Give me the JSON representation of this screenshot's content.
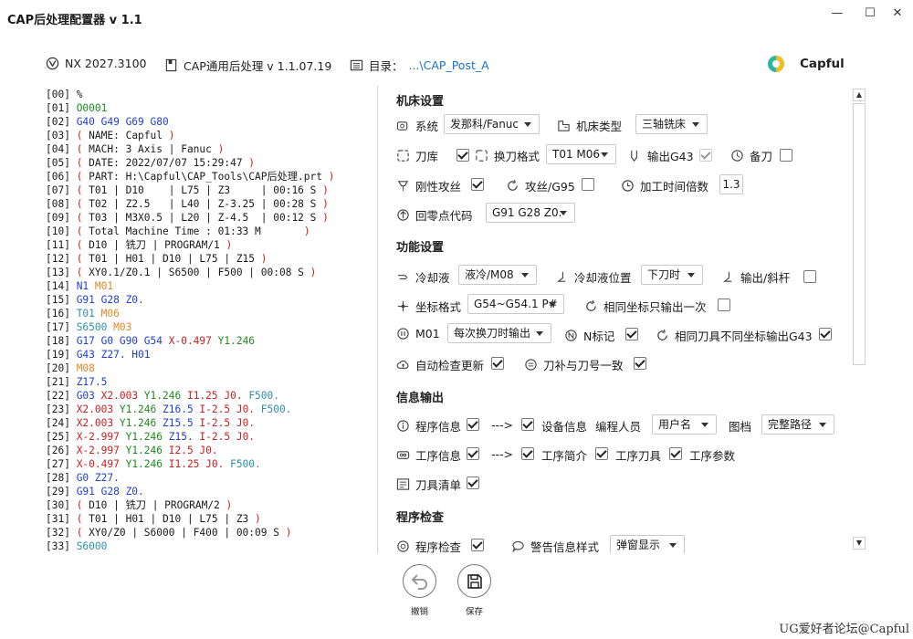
{
  "window": {
    "title": "CAP后处理配置器 v 1.1",
    "minimize": "—",
    "maximize": "☐",
    "close": "✕"
  },
  "info": {
    "nx": "NX 2027.3100",
    "post": "CAP通用后处理 v 1.1.07.19",
    "dir_label": "目录：",
    "dir_value": "...\\CAP_Post_A",
    "brand": "Capful"
  },
  "code_lines": [
    [
      [
        "[00] ",
        "k"
      ],
      [
        "%",
        "k"
      ]
    ],
    [
      [
        "[01] ",
        "k"
      ],
      [
        "O0001",
        "g"
      ]
    ],
    [
      [
        "[02] ",
        "k"
      ],
      [
        "G40 G49 G69 G80",
        "b"
      ]
    ],
    [
      [
        "[03] ",
        "k"
      ],
      [
        "( ",
        "r"
      ],
      [
        "NAME: Capful",
        "k"
      ],
      [
        " )",
        "r"
      ]
    ],
    [
      [
        "[04] ",
        "k"
      ],
      [
        "( ",
        "r"
      ],
      [
        "MACH: 3 Axis | Fanuc",
        "k"
      ],
      [
        " )",
        "r"
      ]
    ],
    [
      [
        "[05] ",
        "k"
      ],
      [
        "( ",
        "r"
      ],
      [
        "DATE: 2022/07/07 15:29:47",
        "k"
      ],
      [
        " )",
        "r"
      ]
    ],
    [
      [
        "[06] ",
        "k"
      ],
      [
        "( ",
        "r"
      ],
      [
        "PART: H:\\Capful\\CAP_Tools\\CAP后处理.prt",
        "k"
      ],
      [
        " )",
        "r"
      ]
    ],
    [
      [
        "[07] ",
        "k"
      ],
      [
        "( ",
        "r"
      ],
      [
        "T01 | D10    | L75 | Z3     | 00:16 S",
        "k"
      ],
      [
        " )",
        "r"
      ]
    ],
    [
      [
        "[08] ",
        "k"
      ],
      [
        "( ",
        "r"
      ],
      [
        "T02 | Z2.5   | L40 | Z-3.25 | 00:28 S",
        "k"
      ],
      [
        " )",
        "r"
      ]
    ],
    [
      [
        "[09] ",
        "k"
      ],
      [
        "( ",
        "r"
      ],
      [
        "T03 | M3X0.5 | L20 | Z-4.5  | 00:12 S",
        "k"
      ],
      [
        " )",
        "r"
      ]
    ],
    [
      [
        "[10] ",
        "k"
      ],
      [
        "( ",
        "r"
      ],
      [
        "Total Machine Time : 01:33 M       ",
        "k"
      ],
      [
        ")",
        "r"
      ]
    ],
    [
      [
        "[11] ",
        "k"
      ],
      [
        "( ",
        "r"
      ],
      [
        "D10 | 铣刀 | PROGRAM/1",
        "k"
      ],
      [
        " )",
        "r"
      ]
    ],
    [
      [
        "[12] ",
        "k"
      ],
      [
        "( ",
        "r"
      ],
      [
        "T01 | H01 | D10 | L75 | Z15",
        "k"
      ],
      [
        " )",
        "r"
      ]
    ],
    [
      [
        "[13] ",
        "k"
      ],
      [
        "( ",
        "r"
      ],
      [
        "XY0.1/Z0.1 | S6500 | F500 | 00:08 S",
        "k"
      ],
      [
        " )",
        "r"
      ]
    ],
    [
      [
        "[14] ",
        "k"
      ],
      [
        "N1 ",
        "b"
      ],
      [
        "M01",
        "o"
      ]
    ],
    [
      [
        "[15] ",
        "k"
      ],
      [
        "G91 G28 Z0.",
        "b"
      ]
    ],
    [
      [
        "[16] ",
        "k"
      ],
      [
        "T01 ",
        "c"
      ],
      [
        "M06",
        "o"
      ]
    ],
    [
      [
        "[17] ",
        "k"
      ],
      [
        "S6500 ",
        "c"
      ],
      [
        "M03",
        "o"
      ]
    ],
    [
      [
        "[18] ",
        "k"
      ],
      [
        "G17 G0 G90 G54 ",
        "b"
      ],
      [
        "X-0.497 ",
        "r"
      ],
      [
        "Y1.246",
        "g"
      ]
    ],
    [
      [
        "[19] ",
        "k"
      ],
      [
        "G43 Z27. H01",
        "b"
      ]
    ],
    [
      [
        "[20] ",
        "k"
      ],
      [
        "M08",
        "o"
      ]
    ],
    [
      [
        "[21] ",
        "k"
      ],
      [
        "Z17.5",
        "b"
      ]
    ],
    [
      [
        "[22] ",
        "k"
      ],
      [
        "G03 ",
        "b"
      ],
      [
        "X2.003 ",
        "r"
      ],
      [
        "Y1.246 ",
        "g"
      ],
      [
        "I1.25 J0. ",
        "r"
      ],
      [
        "F500.",
        "c"
      ]
    ],
    [
      [
        "[23] ",
        "k"
      ],
      [
        "X2.003 ",
        "r"
      ],
      [
        "Y1.246 ",
        "g"
      ],
      [
        "Z16.5 ",
        "b"
      ],
      [
        "I-2.5 J0. ",
        "r"
      ],
      [
        "F500.",
        "c"
      ]
    ],
    [
      [
        "[24] ",
        "k"
      ],
      [
        "X2.003 ",
        "r"
      ],
      [
        "Y1.246 ",
        "g"
      ],
      [
        "Z15.5 ",
        "b"
      ],
      [
        "I-2.5 J0.",
        "r"
      ]
    ],
    [
      [
        "[25] ",
        "k"
      ],
      [
        "X-2.997 ",
        "r"
      ],
      [
        "Y1.246 ",
        "g"
      ],
      [
        "Z15. ",
        "b"
      ],
      [
        "I-2.5 J0.",
        "r"
      ]
    ],
    [
      [
        "[26] ",
        "k"
      ],
      [
        "X-2.997 ",
        "r"
      ],
      [
        "Y1.246 ",
        "g"
      ],
      [
        "I2.5 J0.",
        "r"
      ]
    ],
    [
      [
        "[27] ",
        "k"
      ],
      [
        "X-0.497 ",
        "r"
      ],
      [
        "Y1.246 ",
        "g"
      ],
      [
        "I1.25 J0. ",
        "r"
      ],
      [
        "F500.",
        "c"
      ]
    ],
    [
      [
        "[28] ",
        "k"
      ],
      [
        "G0 Z27.",
        "b"
      ]
    ],
    [
      [
        "[29] ",
        "k"
      ],
      [
        "G91 G28 Z0.",
        "b"
      ]
    ],
    [
      [
        "[30] ",
        "k"
      ],
      [
        "( ",
        "r"
      ],
      [
        "D10 | 铣刀 | PROGRAM/2",
        "k"
      ],
      [
        " )",
        "r"
      ]
    ],
    [
      [
        "[31] ",
        "k"
      ],
      [
        "( ",
        "r"
      ],
      [
        "T01 | H01 | D10 | L75 | Z3",
        "k"
      ],
      [
        " )",
        "r"
      ]
    ],
    [
      [
        "[32] ",
        "k"
      ],
      [
        "( ",
        "r"
      ],
      [
        "XY0/Z0 | S6000 | F400 | 00:09 S",
        "k"
      ],
      [
        " )",
        "r"
      ]
    ],
    [
      [
        "[33] ",
        "k"
      ],
      [
        "S6000",
        "c"
      ]
    ]
  ],
  "code_colors": {
    "k": "#1a1a1a",
    "g": "#1e8a1e",
    "b": "#1f3fcf",
    "r": "#c62020",
    "o": "#e0892a",
    "c": "#2b8fa8"
  },
  "sections": {
    "machine": {
      "title": "机床设置",
      "system_label": "系统",
      "system_value": "发那科/Fanuc",
      "type_label": "机床类型",
      "type_value": "三轴铣床",
      "magazine_label": "刀库",
      "magazine_checked": true,
      "toolchange_label": "换刀格式",
      "toolchange_value": "T01 M06",
      "g43_label": "输出G43",
      "g43_checked": true,
      "spare_label": "备刀",
      "spare_checked": false,
      "tap_label": "刚性攻丝",
      "tap_checked": true,
      "g95_label": "攻丝/G95",
      "g95_checked": false,
      "time_label": "加工时间倍数",
      "time_value": "1.3",
      "home_label": "回零点代码",
      "home_value": "G91 G28 Z0."
    },
    "function": {
      "title": "功能设置",
      "coolant_label": "冷却液",
      "coolant_value": "液冷/M08",
      "coolpos_label": "冷却液位置",
      "coolpos_value": "下刀时",
      "tilt_label": "输出/斜杆",
      "tilt_checked": false,
      "coord_label": "坐标格式",
      "coord_value": "G54~G54.1 P#",
      "samecoord_label": "相同坐标只输出一次",
      "samecoord_checked": false,
      "m01_label": "M01",
      "m01_value": "每次换刀时输出",
      "nmark_label": "N标记",
      "nmark_checked": true,
      "sametool_label": "相同刀具不同坐标输出G43",
      "sametool_checked": true,
      "autoupdate_label": "自动检查更新",
      "autoupdate_checked": true,
      "comp_label": "刀补与刀号一致",
      "comp_checked": true
    },
    "output": {
      "title": "信息输出",
      "prog_label": "程序信息",
      "prog_checked": true,
      "arrow1": "--->",
      "device_checked": true,
      "device_label": "设备信息",
      "programmer_label": "编程人员",
      "programmer_value": "用户名",
      "drawing_label": "图档",
      "drawing_value": "完整路径",
      "op_label": "工序信息",
      "op_checked": true,
      "arrow2": "--->",
      "opbrief_checked": true,
      "opbrief_label": "工序简介",
      "optool_checked": true,
      "optool_label": "工序刀具",
      "opparam_checked": true,
      "opparam_label": "工序参数",
      "toollist_label": "刀具清单",
      "toollist_checked": true
    },
    "check": {
      "title": "程序检查",
      "progcheck_label": "程序检查",
      "progcheck_checked": true,
      "warnstyle_label": "警告信息样式",
      "warnstyle_value": "弹窗显示"
    }
  },
  "bottom": {
    "undo_label": "撤销",
    "save_label": "保存"
  },
  "watermark": "UG爱好者论坛@Capful"
}
